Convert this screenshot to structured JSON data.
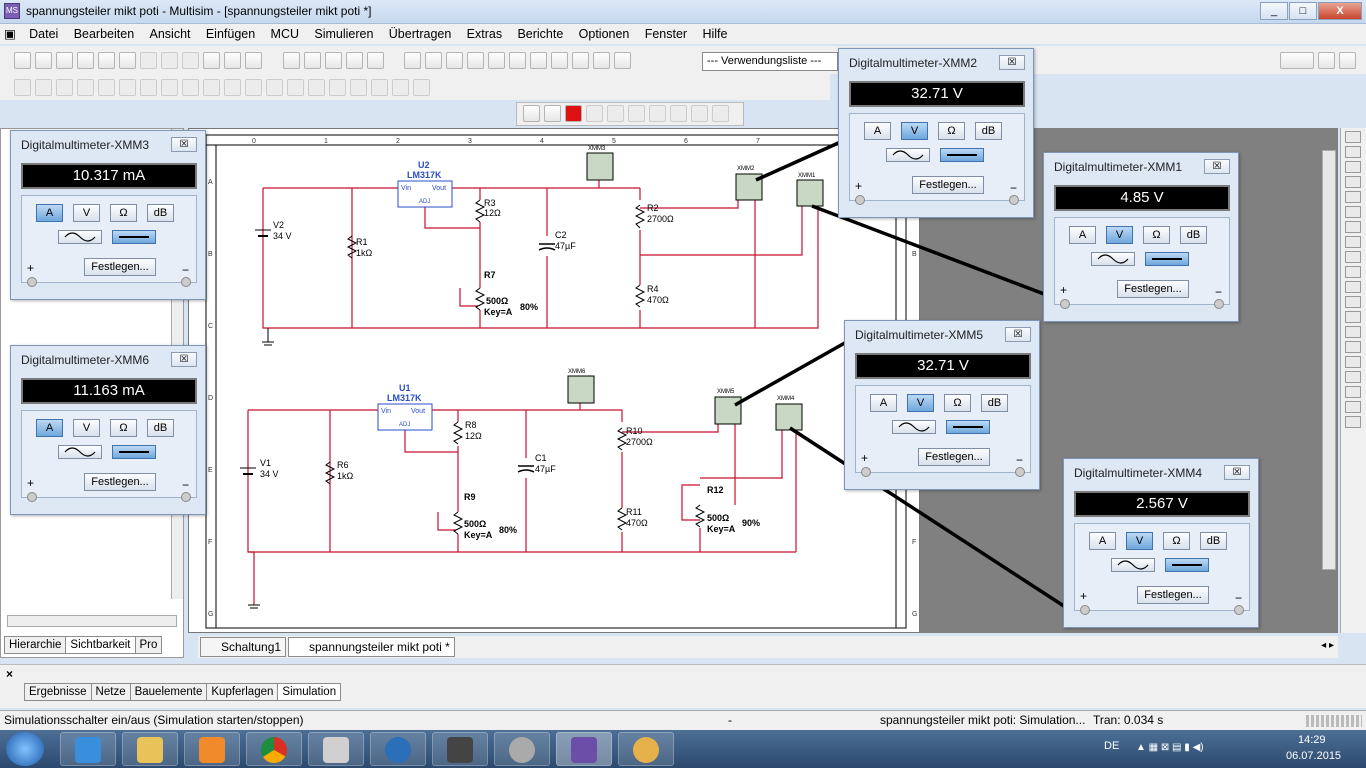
{
  "window": {
    "title": "spannungsteiler mikt poti - Multisim - [spannungsteiler mikt poti *]",
    "buttons": [
      "_",
      "□",
      "X"
    ]
  },
  "menu": [
    "Datei",
    "Bearbeiten",
    "Ansicht",
    "Einfügen",
    "MCU",
    "Simulieren",
    "Übertragen",
    "Extras",
    "Berichte",
    "Optionen",
    "Fenster",
    "Hilfe"
  ],
  "toolbar": {
    "usage_list": "--- Verwendungsliste ---"
  },
  "left_tabs": [
    "Hierarchie",
    "Sichtbarkeit",
    "Pro"
  ],
  "doc_tabs": [
    "Schaltung1",
    "spannungsteiler mikt poti *"
  ],
  "output_tabs": [
    "Ergebnisse",
    "Netze",
    "Bauelemente",
    "Kupferlagen",
    "Simulation"
  ],
  "status": {
    "left": "Simulationsschalter ein/aus (Simulation starten/stoppen)",
    "mid": "-",
    "right": "spannungsteiler mikt poti: Simulation...",
    "tran": "Tran: 0.034 s"
  },
  "taskbar": {
    "lang": "DE",
    "time": "14:29",
    "date": "06.07.2015"
  },
  "multimeters": [
    {
      "id": "xmm3",
      "title": "Digitalmultimeter-XMM3",
      "value": "10.317 mA",
      "mode": "A"
    },
    {
      "id": "xmm6",
      "title": "Digitalmultimeter-XMM6",
      "value": "11.163 mA",
      "mode": "A"
    },
    {
      "id": "xmm2",
      "title": "Digitalmultimeter-XMM2",
      "value": "32.71 V",
      "mode": "V"
    },
    {
      "id": "xmm1",
      "title": "Digitalmultimeter-XMM1",
      "value": "4.85 V",
      "mode": "V"
    },
    {
      "id": "xmm5",
      "title": "Digitalmultimeter-XMM5",
      "value": "32.71 V",
      "mode": "V"
    },
    {
      "id": "xmm4",
      "title": "Digitalmultimeter-XMM4",
      "value": "2.567 V",
      "mode": "V"
    }
  ],
  "dmm_labels": {
    "a": "A",
    "v": "V",
    "ohm": "Ω",
    "db": "dB",
    "set": "Festlegen...",
    "plus": "+",
    "minus": "−"
  },
  "circuit_top": {
    "u": "U2",
    "reg": "LM317K",
    "vin": "Vin",
    "vout": "Vout",
    "adj": "ADJ",
    "v": "V2",
    "v_val": "34 V",
    "r1": "R1",
    "r1_val": "1kΩ",
    "r3": "R3",
    "r3_val": "12Ω",
    "r7": "R7",
    "r7_val": "500Ω",
    "r7_key": "Key=A",
    "r7_pct": "80%",
    "c": "C2",
    "c_val": "47µF",
    "r2": "R2",
    "r2_val": "2700Ω",
    "r4": "R4",
    "r4_val": "470Ω",
    "xmm_a": "XMM3",
    "xmm_b": "XMM2",
    "xmm_c": "XMM1"
  },
  "circuit_bottom": {
    "u": "U1",
    "reg": "LM317K",
    "vin": "Vin",
    "vout": "Vout",
    "adj": "ADJ",
    "v": "V1",
    "v_val": "34 V",
    "r6": "R6",
    "r6_val": "1kΩ",
    "r8": "R8",
    "r8_val": "12Ω",
    "r9": "R9",
    "r9_val": "500Ω",
    "r9_key": "Key=A",
    "r9_pct": "80%",
    "c": "C1",
    "c_val": "47µF",
    "r10": "R10",
    "r10_val": "2700Ω",
    "r11": "R11",
    "r11_val": "470Ω",
    "r12": "R12",
    "r12_val": "500Ω",
    "r12_key": "Key=A",
    "r12_pct": "90%",
    "xmm_a": "XMM6",
    "xmm_b": "XMM5",
    "xmm_c": "XMM4"
  },
  "ruler_cols": [
    "0",
    "1",
    "2",
    "3",
    "4",
    "5",
    "6",
    "7"
  ],
  "ruler_rows": [
    "A",
    "B",
    "C",
    "D",
    "E",
    "F",
    "G"
  ]
}
